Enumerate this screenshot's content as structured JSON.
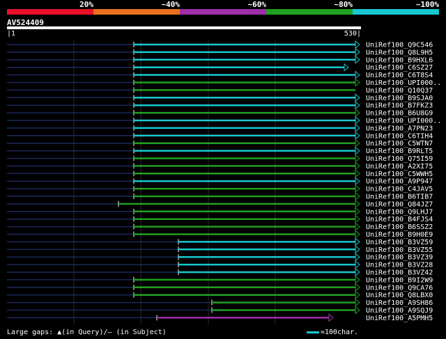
{
  "legend": {
    "labels": [
      "20%",
      "~40%",
      "~60%",
      "~80%",
      "~100%"
    ],
    "colors": [
      "#e8102a",
      "#e87020",
      "#a02ea8",
      "#20a020",
      "#18c8d0"
    ]
  },
  "query": {
    "id": "AV524409",
    "start": "1",
    "end": "530"
  },
  "hits": [
    {
      "name": "UniRef100_Q9C546",
      "color": "cyan",
      "arrow": true
    },
    {
      "name": "UniRef100_Q8L9H5",
      "color": "cyan",
      "arrow": true
    },
    {
      "name": "UniRef100_B9HXL6",
      "color": "cyan",
      "arrow": true
    },
    {
      "name": "UniRef100_C6SZ27",
      "color": "cyan",
      "arrow": true
    },
    {
      "name": "UniRef100_C6T8S4",
      "color": "cyan",
      "arrow": true
    },
    {
      "name": "UniRef100_UPI000..",
      "color": "green",
      "arrow": true
    },
    {
      "name": "UniRef100_Q10Q37",
      "color": "green",
      "arrow": false
    },
    {
      "name": "UniRef100_B9SJA0",
      "color": "cyan",
      "arrow": true
    },
    {
      "name": "UniRef100_B7FKZ3",
      "color": "cyan",
      "arrow": true
    },
    {
      "name": "UniRef100_B6U8G9",
      "color": "green",
      "arrow": true
    },
    {
      "name": "UniRef100_UPI000..",
      "color": "cyan",
      "arrow": true
    },
    {
      "name": "UniRef100_A7PN23",
      "color": "cyan",
      "arrow": true
    },
    {
      "name": "UniRef100_C6TIH4",
      "color": "cyan",
      "arrow": true
    },
    {
      "name": "UniRef100_C5WTN7",
      "color": "green",
      "arrow": true
    },
    {
      "name": "UniRef100_B9RLT5",
      "color": "cyan",
      "arrow": true
    },
    {
      "name": "UniRef100_Q75I59",
      "color": "green",
      "arrow": true
    },
    {
      "name": "UniRef100_A2XI75",
      "color": "green",
      "arrow": true
    },
    {
      "name": "UniRef100_C5WWH5",
      "color": "green",
      "arrow": true
    },
    {
      "name": "UniRef100_A9P947",
      "color": "cyan",
      "arrow": true
    },
    {
      "name": "UniRef100_C4JAV5",
      "color": "green",
      "arrow": true
    },
    {
      "name": "UniRef100_B6TIB7",
      "color": "green",
      "arrow": true
    },
    {
      "name": "UniRef100_Q84JZ7",
      "color": "green",
      "arrow": true
    },
    {
      "name": "UniRef100_Q9LHJ7",
      "color": "green",
      "arrow": true
    },
    {
      "name": "UniRef100_B4FJS4",
      "color": "green",
      "arrow": true
    },
    {
      "name": "UniRef100_B6SSZ2",
      "color": "green",
      "arrow": true
    },
    {
      "name": "UniRef100_B9H0E9",
      "color": "green",
      "arrow": true
    },
    {
      "name": "UniRef100_B3VZ59",
      "color": "cyan",
      "arrow": true
    },
    {
      "name": "UniRef100_B3VZ55",
      "color": "cyan",
      "arrow": true
    },
    {
      "name": "UniRef100_B3VZ39",
      "color": "cyan",
      "arrow": true
    },
    {
      "name": "UniRef100_B3VZ28",
      "color": "cyan",
      "arrow": true
    },
    {
      "name": "UniRef100_B3VZ42",
      "color": "cyan",
      "arrow": true
    },
    {
      "name": "UniRef100_B9I2W9",
      "color": "green",
      "arrow": true
    },
    {
      "name": "UniRef100_Q9CA76",
      "color": "green",
      "arrow": true
    },
    {
      "name": "UniRef100_Q8LBX0",
      "color": "green",
      "arrow": true
    },
    {
      "name": "UniRef100_A9SH86",
      "color": "green",
      "arrow": true
    },
    {
      "name": "UniRef100_A9SQJ9",
      "color": "green",
      "arrow": true
    },
    {
      "name": "UniRef100_A5PMH5",
      "color": "purple",
      "arrow": true
    }
  ],
  "footer": {
    "gaps_text": "Large gaps: ▲(in Query)/– (in Subject)",
    "scale_text": "=100char."
  }
}
